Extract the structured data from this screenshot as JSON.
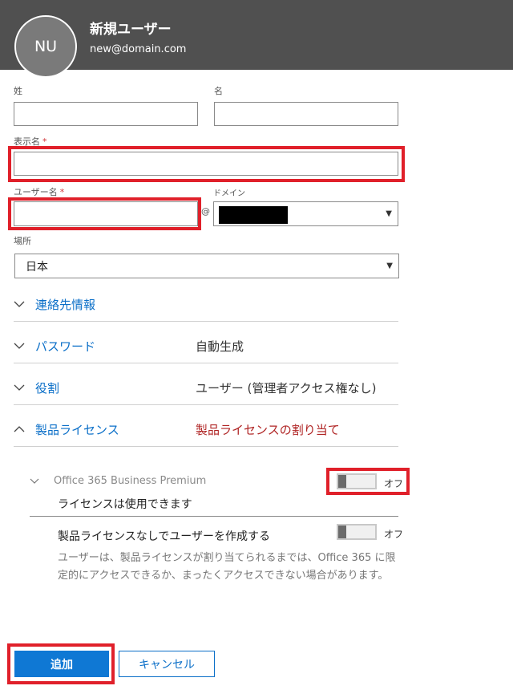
{
  "header": {
    "avatar_initials": "NU",
    "title": "新規ユーザー",
    "subtitle": "new@domain.com"
  },
  "form": {
    "last_name_label": "姓",
    "first_name_label": "名",
    "display_name_label": "表示名",
    "required_mark": "*",
    "username_label": "ユーザー名",
    "at_sign": "@",
    "domain_label": "ドメイン",
    "domain_value": "",
    "location_label": "場所",
    "location_value": "日本"
  },
  "sections": [
    {
      "label": "連絡先情報",
      "value": ""
    },
    {
      "label": "パスワード",
      "value": "自動生成"
    },
    {
      "label": "役割",
      "value": "ユーザー (管理者アクセス権なし)"
    },
    {
      "label": "製品ライセンス",
      "value": "製品ライセンスの割り当て"
    }
  ],
  "license": {
    "product_name": "Office 365 Business Premium",
    "toggle_state": "オフ",
    "availability": "ライセンスは使用できます",
    "no_license_title": "製品ライセンスなしでユーザーを作成する",
    "no_license_toggle_state": "オフ",
    "no_license_description": "ユーザーは、製品ライセンスが割り当てられるまでは、Office 365 に限定的にアクセスできるか、まったくアクセスできない場合があります。"
  },
  "buttons": {
    "add": "追加",
    "cancel": "キャンセル"
  },
  "colors": {
    "header_bg": "#505050",
    "accent": "#0f78d4",
    "highlight_box": "#e0202a",
    "warning_text": "#b02525"
  }
}
